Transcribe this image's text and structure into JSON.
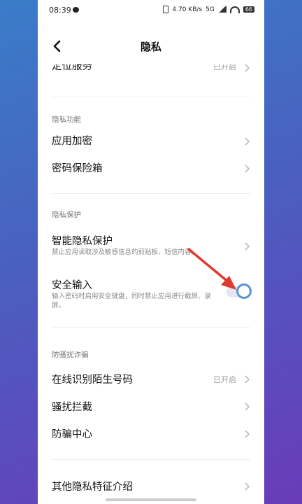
{
  "status": {
    "time": "08:39",
    "right_text": "4.70 KB/s",
    "net": "5G",
    "battery": "66"
  },
  "header": {
    "title": "隐私"
  },
  "rows": {
    "location": {
      "label": "定位服务",
      "value": "已开启"
    },
    "app_lock": {
      "label": "应用加密"
    },
    "vault": {
      "label": "密码保险箱"
    },
    "smart_privacy": {
      "label": "智能隐私保护",
      "sub": "禁止应用读取涉及敏感信息的剪贴板、短信内容。"
    },
    "secure_input": {
      "label": "安全输入",
      "sub": "输入密码时启用安全键盘，同时禁止应用进行截屏、录屏。",
      "enabled": true
    },
    "online_id": {
      "label": "在线识别陌生号码",
      "value": "已开启"
    },
    "block": {
      "label": "骚扰拦截"
    },
    "anti_fraud": {
      "label": "防骗中心"
    },
    "other": {
      "label": "其他隐私特征介绍"
    }
  },
  "sections": {
    "privacy_features": "隐私功能",
    "privacy_protection": "隐私保护",
    "anti_harass": "防骚扰诈骗"
  },
  "colors": {
    "accent": "#5a93d8",
    "arrow": "#e03a2f"
  }
}
